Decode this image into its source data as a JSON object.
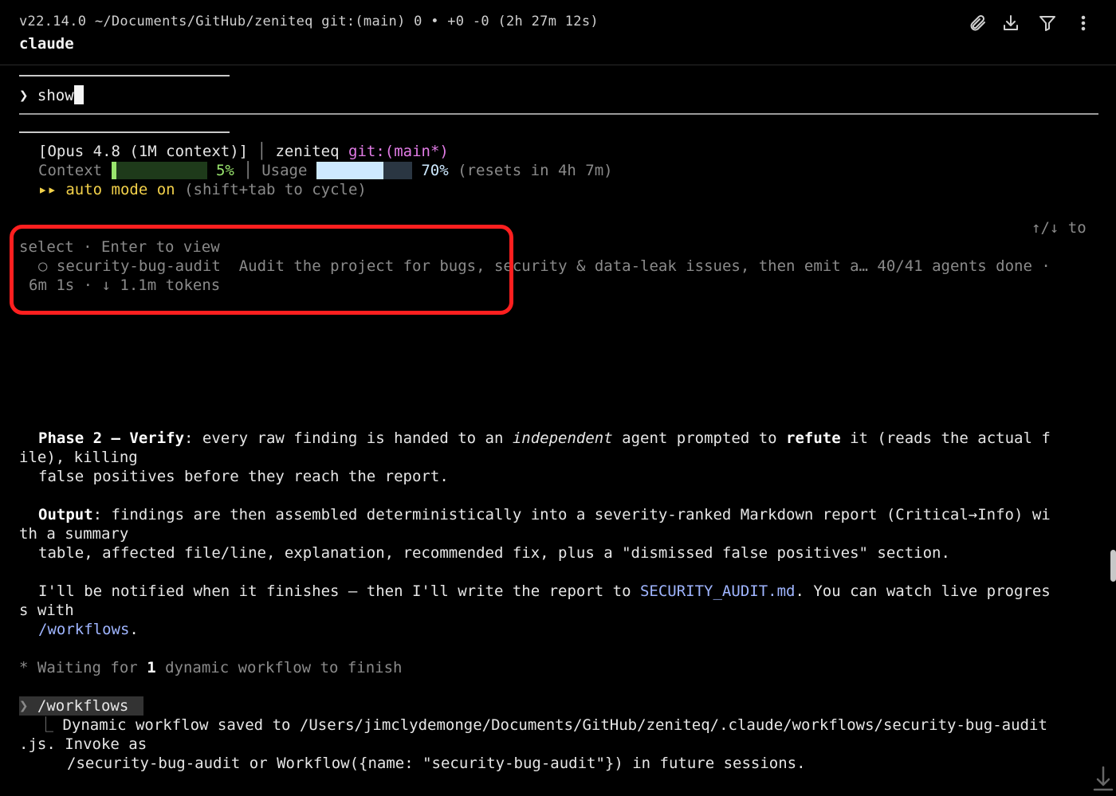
{
  "header": {
    "subtitle": "v22.14.0 ~/Documents/GitHub/zeniteq git:(main) 0 • +0 -0 (2h 27m 12s)",
    "title": "claude",
    "icons": [
      "paperclip-icon",
      "download-icon",
      "filter-icon",
      "more-vertical-icon"
    ]
  },
  "prompt": {
    "symbol": "❯",
    "text": "show"
  },
  "status": {
    "model_open": "[Opus 4.8 (1M context)]",
    "separator": "│",
    "repo": "zeniteq",
    "branch": "git:(main*)",
    "context_label": "Context",
    "context_pct": "5%",
    "context_fraction": 0.05,
    "usage_label": "Usage",
    "usage_pct": "70%",
    "usage_fraction": 0.7,
    "resets": "(resets in 4h 7m)",
    "mode_arrows": "▸▸",
    "mode_text": "auto mode on",
    "mode_hint": "(shift+tab to cycle)"
  },
  "workflow_list": {
    "nav_hint": "↑/↓ to",
    "select_hint": "select · Enter to view",
    "item_bullet": "○",
    "item_name": "security-bug-audit",
    "item_desc": "Audit the project for bugs, security & data-leak issues, then emit a… 40/41 agents done ·",
    "item_stats": "6m 1s · ↓ 1.1m tokens"
  },
  "body": {
    "phase2_label": "Phase 2 — Verify",
    "phase2_a": ": every raw finding is handed to an ",
    "phase2_ital": "independent",
    "phase2_b": " agent prompted to ",
    "phase2_bold": "refute",
    "phase2_c": " it (reads the actual f",
    "phase2_wrap": "ile), killing",
    "phase2_line2": "false positives before they reach the report.",
    "output_label": "Output",
    "output_a": ": findings are then assembled deterministically into a severity-ranked Markdown report (Critical→Info) wi",
    "output_wrap": "th a summary",
    "output_line2": "table, affected file/line, explanation, recommended fix, plus a \"dismissed false positives\" section.",
    "notify_a": "I'll be notified when it finishes — then I'll write the report to ",
    "notify_link": "SECURITY_AUDIT.md",
    "notify_b": ". You can watch live progres",
    "notify_wrap": "s with",
    "notify_link2": "/workflows",
    "notify_end": ".",
    "waiting_star": "*",
    "waiting_a": "Waiting for ",
    "waiting_num": "1",
    "waiting_b": " dynamic workflow to finish"
  },
  "command": {
    "symbol": "❯",
    "text": "/workflows",
    "result_branch": "⎿",
    "result_line1": "Dynamic workflow saved to /Users/jimclydemonge/Documents/GitHub/zeniteq/.claude/workflows/security-bug-audit",
    "result_line2": ".js. Invoke as",
    "result_line3": "/security-bug-audit or Workflow({name: \"security-bug-audit\"}) in future sessions."
  },
  "colors": {
    "highlight": "#ff1f1f",
    "accent_yellow": "#f3d14a",
    "context_green": "#9ae66e",
    "usage_blue": "#cde9ff",
    "branch_magenta": "#e27ce6",
    "link_blue": "#9fb5ff"
  }
}
